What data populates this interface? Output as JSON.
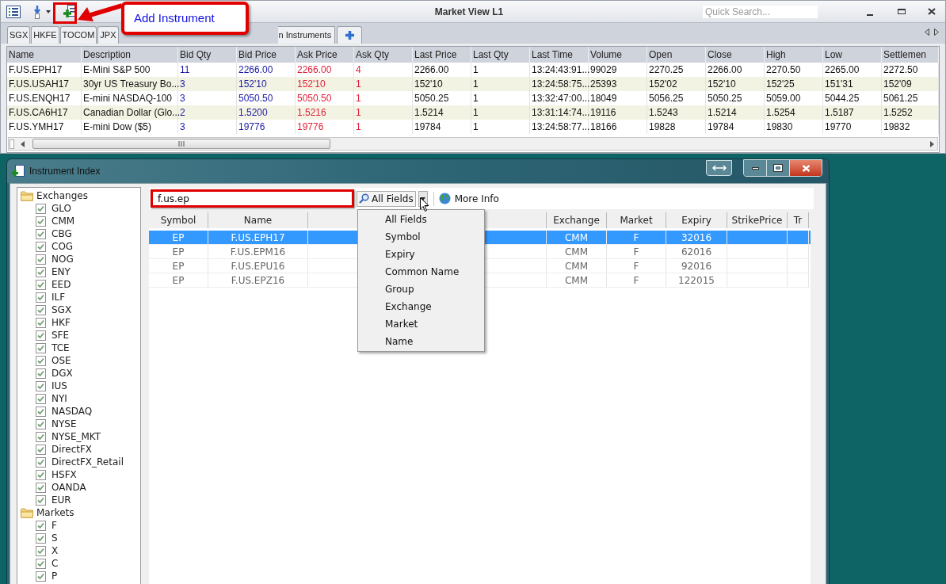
{
  "market_view": {
    "title": "Market View L1",
    "quick_search": {
      "placeholder": "Quick Search..."
    },
    "tabs": [
      "SGX",
      "HKFE",
      "TOCOM",
      "JPX",
      "n Instruments"
    ],
    "grid": {
      "columns": [
        {
          "label": "Name",
          "kind": "plain"
        },
        {
          "label": "Description",
          "kind": "plain"
        },
        {
          "label": "Bid Qty",
          "kind": "bid"
        },
        {
          "label": "Bid Price",
          "kind": "bid"
        },
        {
          "label": "Ask Price",
          "kind": "ask"
        },
        {
          "label": "Ask Qty",
          "kind": "ask"
        },
        {
          "label": "Last Price",
          "kind": "plain"
        },
        {
          "label": "Last Qty",
          "kind": "plain"
        },
        {
          "label": "Last Time",
          "kind": "plain"
        },
        {
          "label": "Volume",
          "kind": "plain"
        },
        {
          "label": "Open",
          "kind": "plain"
        },
        {
          "label": "Close",
          "kind": "plain"
        },
        {
          "label": "High",
          "kind": "plain"
        },
        {
          "label": "Low",
          "kind": "plain"
        },
        {
          "label": "Settlemen",
          "kind": "plain"
        }
      ],
      "rows": [
        [
          "F.US.EPH17",
          "E-Mini S&P 500",
          "11",
          "2266.00",
          "2266.00",
          "4",
          "2266.00",
          "1",
          "13:24:43:91...",
          "99029",
          "2270.25",
          "2266.00",
          "2270.50",
          "2265.00",
          "2272.50"
        ],
        [
          "F.US.USAH17",
          "30yr US Treasury Bo...",
          "3",
          "152'10",
          "152'10",
          "1",
          "152'10",
          "1",
          "13:24:58:75...",
          "25393",
          "152'02",
          "152'10",
          "152'25",
          "151'31",
          "152'09"
        ],
        [
          "F.US.ENQH17",
          "E-mini NASDAQ-100",
          "3",
          "5050.50",
          "5050.50",
          "1",
          "5050.25",
          "1",
          "13:32:47:00...",
          "18049",
          "5056.25",
          "5050.25",
          "5059.00",
          "5044.25",
          "5061.25"
        ],
        [
          "F.US.CA6H17",
          "Canadian Dollar (Glo...",
          "2",
          "1.5200",
          "1.5216",
          "1",
          "1.5214",
          "1",
          "13:31:14:74...",
          "19116",
          "1.5243",
          "1.5214",
          "1.5254",
          "1.5187",
          "1.5252"
        ],
        [
          "F.US.YMH17",
          "E-mini Dow ($5)",
          "3",
          "19776",
          "19776",
          "1",
          "19784",
          "1",
          "13:24:58:77...",
          "18166",
          "19828",
          "19784",
          "19830",
          "19770",
          "19832"
        ]
      ]
    }
  },
  "callout": {
    "text": "Add Instrument"
  },
  "instrument_index": {
    "title": "Instrument Index",
    "tree": [
      {
        "label": "Exchanges",
        "children": [
          {
            "label": "GLO",
            "checked": true
          },
          {
            "label": "CMM",
            "checked": true
          },
          {
            "label": "CBG",
            "checked": true
          },
          {
            "label": "COG",
            "checked": true
          },
          {
            "label": "NOG",
            "checked": true
          },
          {
            "label": "ENY",
            "checked": true
          },
          {
            "label": "EED",
            "checked": true
          },
          {
            "label": "ILF",
            "checked": true
          },
          {
            "label": "SGX",
            "checked": true
          },
          {
            "label": "HKF",
            "checked": true
          },
          {
            "label": "SFE",
            "checked": true
          },
          {
            "label": "TCE",
            "checked": true
          },
          {
            "label": "OSE",
            "checked": true
          },
          {
            "label": "DGX",
            "checked": true
          },
          {
            "label": "IUS",
            "checked": true
          },
          {
            "label": "NYI",
            "checked": true
          },
          {
            "label": "NASDAQ",
            "checked": true
          },
          {
            "label": "NYSE",
            "checked": true
          },
          {
            "label": "NYSE_MKT",
            "checked": true
          },
          {
            "label": "DirectFX",
            "checked": true
          },
          {
            "label": "DirectFX_Retail",
            "checked": true
          },
          {
            "label": "HSFX",
            "checked": true
          },
          {
            "label": "OANDA",
            "checked": true
          },
          {
            "label": "EUR",
            "checked": true
          }
        ]
      },
      {
        "label": "Markets",
        "children": [
          {
            "label": "F",
            "checked": true
          },
          {
            "label": "S",
            "checked": true
          },
          {
            "label": "X",
            "checked": true
          },
          {
            "label": "C",
            "checked": true
          },
          {
            "label": "P",
            "checked": true
          }
        ]
      }
    ],
    "search": {
      "value": "f.us.ep"
    },
    "field_filter": "All Fields",
    "more_info": "More Info",
    "grid": {
      "columns": [
        "Symbol",
        "Name",
        "Exchange",
        "Market",
        "Expiry",
        "StrikePrice",
        "Tr"
      ],
      "rows": [
        {
          "selected": true,
          "cells": [
            "EP",
            "F.US.EPH17",
            "CMM",
            "F",
            "32016",
            "",
            ""
          ]
        },
        {
          "selected": false,
          "cells": [
            "EP",
            "F.US.EPM16",
            "CMM",
            "F",
            "62016",
            "",
            ""
          ]
        },
        {
          "selected": false,
          "cells": [
            "EP",
            "F.US.EPU16",
            "CMM",
            "F",
            "92016",
            "",
            ""
          ]
        },
        {
          "selected": false,
          "cells": [
            "EP",
            "F.US.EPZ16",
            "CMM",
            "F",
            "122015",
            "",
            ""
          ]
        }
      ]
    },
    "field_menu": [
      "All Fields",
      "Symbol",
      "Expiry",
      "Common Name",
      "Group",
      "Exchange",
      "Market",
      "Name"
    ]
  }
}
